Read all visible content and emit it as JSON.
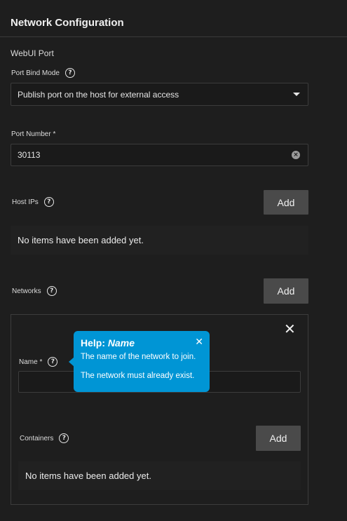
{
  "header": {
    "title": "Network Configuration"
  },
  "webui": {
    "title": "WebUI Port",
    "bind_mode": {
      "label": "Port Bind Mode",
      "value": "Publish port on the host for external access"
    },
    "port_number": {
      "label": "Port Number *",
      "value": "30113"
    }
  },
  "host_ips": {
    "label": "Host IPs",
    "add_label": "Add",
    "empty_text": "No items have been added yet."
  },
  "networks": {
    "label": "Networks",
    "add_label": "Add",
    "item": {
      "name_label": "Name *",
      "name_value": "",
      "containers_label": "Containers",
      "containers_add_label": "Add",
      "containers_empty_text": "No items have been added yet."
    }
  },
  "tooltip": {
    "title_prefix": "Help:",
    "title_field": "Name",
    "line1": "The name of the network to join.",
    "line2": "The network must already exist."
  },
  "icons": {
    "help": "question-circle-icon",
    "dropdown": "caret-down-icon",
    "clear": "clear-circle-icon",
    "close": "close-icon"
  },
  "colors": {
    "background": "#1e1e1e",
    "button": "#4a4a4a",
    "tooltip": "#0095d5"
  }
}
